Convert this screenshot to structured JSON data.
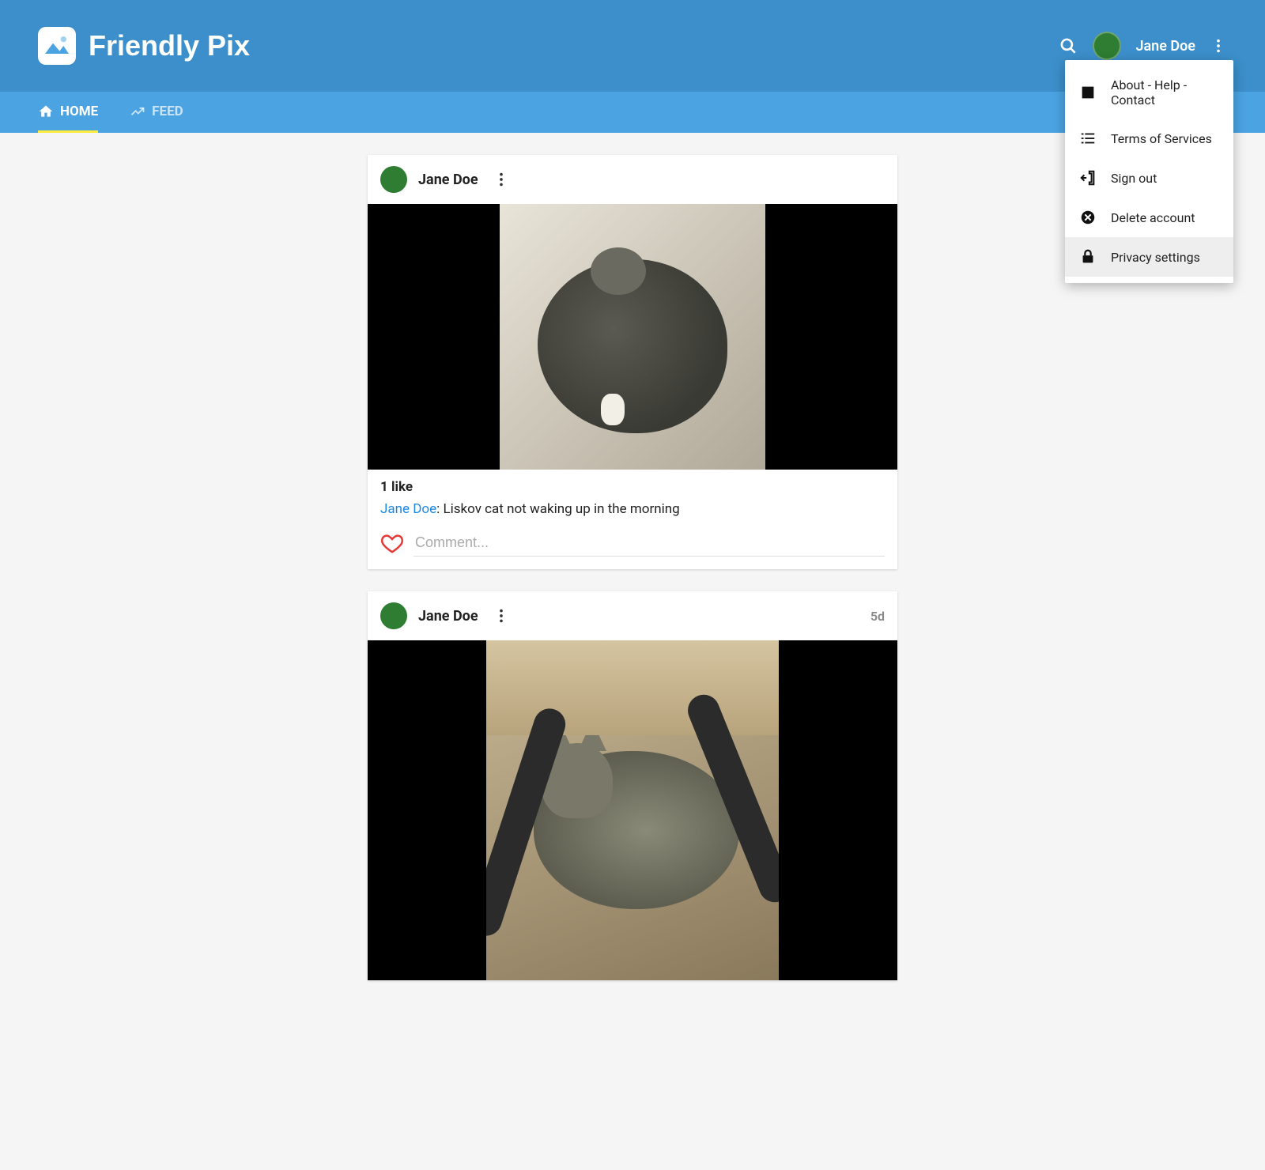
{
  "app": {
    "title": "Friendly Pix"
  },
  "header": {
    "username": "Jane Doe"
  },
  "tabs": {
    "home": "HOME",
    "feed": "FEED"
  },
  "dropdown": {
    "about": "About - Help - Contact",
    "terms": "Terms of Services",
    "signout": "Sign out",
    "delete": "Delete account",
    "privacy": "Privacy settings"
  },
  "posts": [
    {
      "author": "Jane Doe",
      "likes": "1 like",
      "caption_author": "Jane Doe",
      "caption_text": ": Liskov cat not waking up in the morning",
      "comment_placeholder": "Comment...",
      "time": ""
    },
    {
      "author": "Jane Doe",
      "time": "5d"
    }
  ]
}
